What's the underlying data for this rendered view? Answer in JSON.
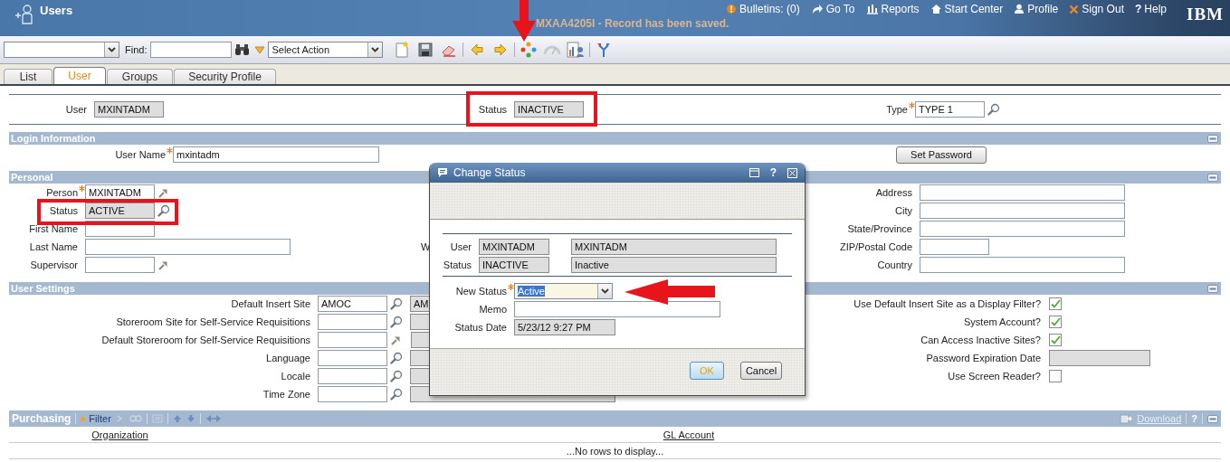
{
  "header": {
    "title": "Users",
    "message": "MXAA4205I - Record has been saved.",
    "links": [
      {
        "label": "Bulletins: (0)"
      },
      {
        "label": "Go To"
      },
      {
        "label": "Reports"
      },
      {
        "label": "Start Center"
      },
      {
        "label": "Profile"
      },
      {
        "label": "Sign Out"
      },
      {
        "label": "Help",
        "symbol": "?"
      }
    ],
    "logo": "IBM"
  },
  "toolbar": {
    "find_label": "Find:",
    "action": "Select Action"
  },
  "tabs": [
    {
      "label": "List",
      "selected": false
    },
    {
      "label": "User",
      "selected": true
    },
    {
      "label": "Groups",
      "selected": false
    },
    {
      "label": "Security Profile",
      "selected": false
    }
  ],
  "record": [
    {
      "label": "User",
      "value": "MXINTADM",
      "readonly": true,
      "required": false
    },
    {
      "label": "Status",
      "value": "INACTIVE",
      "readonly": true,
      "required": false
    },
    {
      "label": "Type",
      "value": "TYPE 1",
      "readonly": false,
      "required": true
    }
  ],
  "login": {
    "title": "Login Information",
    "user_name": {
      "label": "User Name",
      "value": "mxintadm",
      "readonly": false,
      "required": true
    },
    "button": "Set Password"
  },
  "personal": {
    "title": "Personal",
    "partial_label": "W",
    "left": [
      {
        "label": "Person",
        "value": "MXINTADM",
        "readonly": false,
        "required": true
      },
      {
        "label": "Status",
        "value": "ACTIVE",
        "readonly": true,
        "required": false
      },
      {
        "label": "First Name",
        "readonly": false,
        "required": false
      },
      {
        "label": "Last Name",
        "readonly": false,
        "required": false
      },
      {
        "label": "Supervisor",
        "readonly": false,
        "required": false
      }
    ],
    "right": [
      {
        "label": "Address",
        "readonly": false,
        "required": false
      },
      {
        "label": "City",
        "readonly": false,
        "required": false
      },
      {
        "label": "State/Province",
        "readonly": false,
        "required": false
      },
      {
        "label": "ZIP/Postal Code",
        "readonly": false,
        "required": false
      },
      {
        "label": "Country",
        "readonly": false,
        "required": false
      }
    ]
  },
  "user_settings": {
    "title": "User Settings",
    "left": [
      {
        "label": "Default Insert Site",
        "value": "AMOC",
        "description": "AM",
        "readonly": false,
        "required": false
      },
      {
        "label": "Storeroom Site for Self-Service Requisitions",
        "readonly": false,
        "required": false
      },
      {
        "label": "Default Storeroom for Self-Service Requisitions",
        "readonly": false,
        "required": false
      },
      {
        "label": "Language",
        "readonly": false,
        "required": false
      },
      {
        "label": "Locale",
        "readonly": false,
        "required": false
      },
      {
        "label": "Time Zone",
        "readonly": false,
        "required": false
      }
    ],
    "right": [
      {
        "kind": "checkbox",
        "label": "Use Default Insert Site as a Display Filter?",
        "checked": true
      },
      {
        "kind": "checkbox",
        "label": "System Account?",
        "checked": true
      },
      {
        "kind": "checkbox",
        "label": "Can Access Inactive Sites?",
        "checked": true
      },
      {
        "kind": "field",
        "label": "Password Expiration Date",
        "readonly": true,
        "required": false
      },
      {
        "kind": "checkbox",
        "label": "Use Screen Reader?",
        "checked": false
      }
    ]
  },
  "purchasing": {
    "title": "Purchasing",
    "filter": "Filter",
    "download": "Download",
    "help": "?",
    "columns": [
      "Organization",
      "GL Account"
    ],
    "empty": "...No rows to display..."
  },
  "dialog": {
    "title": "Change Status",
    "help": "?",
    "user": {
      "label": "User",
      "value": "MXINTADM",
      "description": "MXINTADM"
    },
    "status": {
      "label": "Status",
      "value": "INACTIVE",
      "description": "Inactive"
    },
    "new_status": {
      "label": "New Status",
      "value": "Active",
      "required": true
    },
    "memo": {
      "label": "Memo",
      "readonly": false,
      "required": false
    },
    "status_date": {
      "label": "Status Date",
      "value": "5/23/12 9:27 PM",
      "readonly": true,
      "required": false
    },
    "buttons": [
      {
        "label": "OK",
        "default": true
      },
      {
        "label": "Cancel",
        "default": false
      }
    ]
  },
  "annotations": [
    {
      "kind": "frame"
    },
    {
      "kind": "frame"
    },
    {
      "kind": "arrow"
    },
    {
      "kind": "arrow"
    }
  ]
}
